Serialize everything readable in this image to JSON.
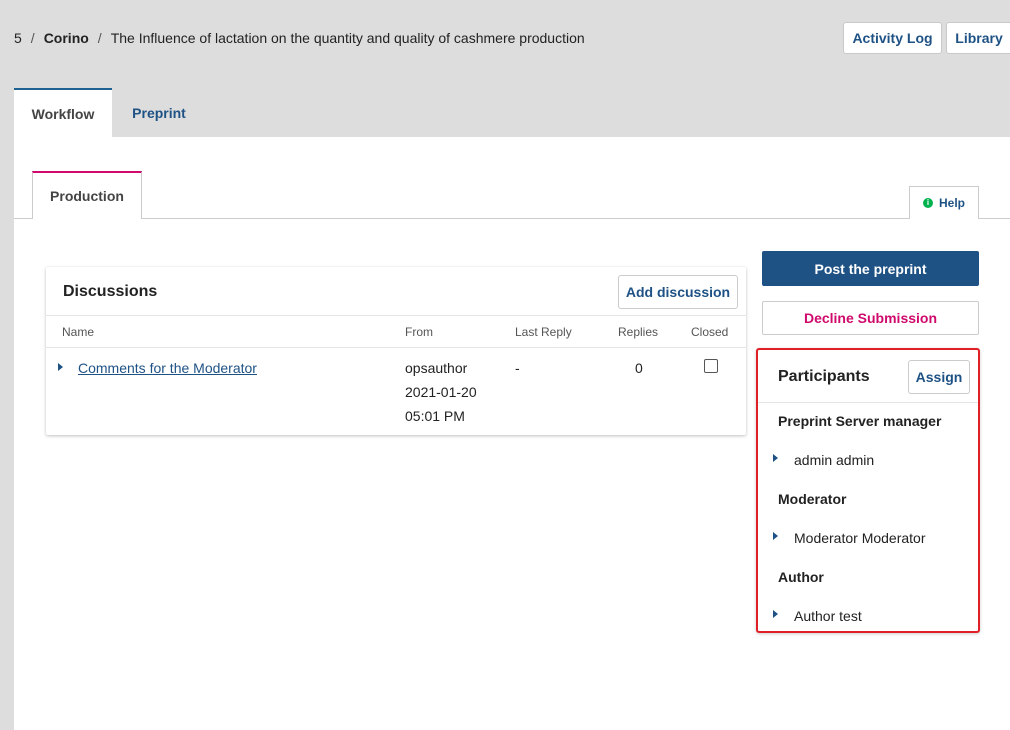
{
  "breadcrumb": {
    "id": "5",
    "author": "Corino",
    "title": "The Influence of lactation on the quantity and quality of cashmere production"
  },
  "header_buttons": {
    "activity_log": "Activity Log",
    "library": "Library"
  },
  "main_tabs": [
    {
      "label": "Workflow",
      "active": true
    },
    {
      "label": "Preprint",
      "active": false
    }
  ],
  "sub_tabs": [
    {
      "label": "Production",
      "active": true
    }
  ],
  "help": {
    "label": "Help",
    "icon": "info-icon"
  },
  "discussions": {
    "title": "Discussions",
    "add_label": "Add discussion",
    "columns": [
      "Name",
      "From",
      "Last Reply",
      "Replies",
      "Closed"
    ],
    "rows": [
      {
        "name": "Comments for the Moderator",
        "from_user": "opsauthor",
        "from_date": "2021-01-20",
        "from_time": "05:01 PM",
        "last_reply": "-",
        "replies": "0",
        "closed": false
      }
    ]
  },
  "actions": {
    "post": "Post the preprint",
    "decline": "Decline Submission"
  },
  "participants": {
    "title": "Participants",
    "assign_label": "Assign",
    "groups": [
      {
        "role": "Preprint Server manager",
        "members": [
          "admin admin"
        ]
      },
      {
        "role": "Moderator",
        "members": [
          "Moderator Moderator"
        ]
      },
      {
        "role": "Author",
        "members": [
          "Author test"
        ]
      }
    ]
  },
  "colors": {
    "accent": "#1e5285",
    "danger": "#d00a6c",
    "highlight": "#e01f26"
  }
}
